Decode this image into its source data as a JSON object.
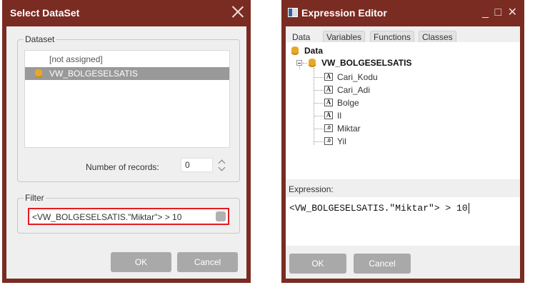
{
  "select_dataset": {
    "title": "Select DataSet",
    "dataset_group_label": "Dataset",
    "items": [
      "[not assigned]",
      "VW_BOLGESELSATIS"
    ],
    "number_of_records_label": "Number of records:",
    "number_of_records_value": "0",
    "filter_group_label": "Filter",
    "filter_value": "<VW_BOLGESELSATIS.\"Miktar\"> > 10",
    "ok_label": "OK",
    "cancel_label": "Cancel"
  },
  "expression_editor": {
    "title": "Expression Editor",
    "window_controls": "_ □ ✕",
    "tabs": [
      "Data",
      "Variables",
      "Functions",
      "Classes"
    ],
    "tree": {
      "root": "Data",
      "dataset": "VW_BOLGESELSATIS",
      "fields": [
        {
          "name": "Cari_Kodu",
          "type": "A"
        },
        {
          "name": "Cari_Adi",
          "type": "A"
        },
        {
          "name": "Bolge",
          "type": "A"
        },
        {
          "name": "Il",
          "type": "A"
        },
        {
          "name": "Miktar",
          "type": ".0"
        },
        {
          "name": "Yil",
          "type": ".0"
        }
      ]
    },
    "expression_label": "Expression:",
    "expression_value": "<VW_BOLGESELSATIS.\"Miktar\"> > 10",
    "ok_label": "OK",
    "cancel_label": "Cancel"
  },
  "colors": {
    "titlebar": "#7a2b22",
    "client": "#efefef",
    "selection": "#999999",
    "filter_highlight": "#e31b23",
    "button": "#a9a9a9"
  }
}
